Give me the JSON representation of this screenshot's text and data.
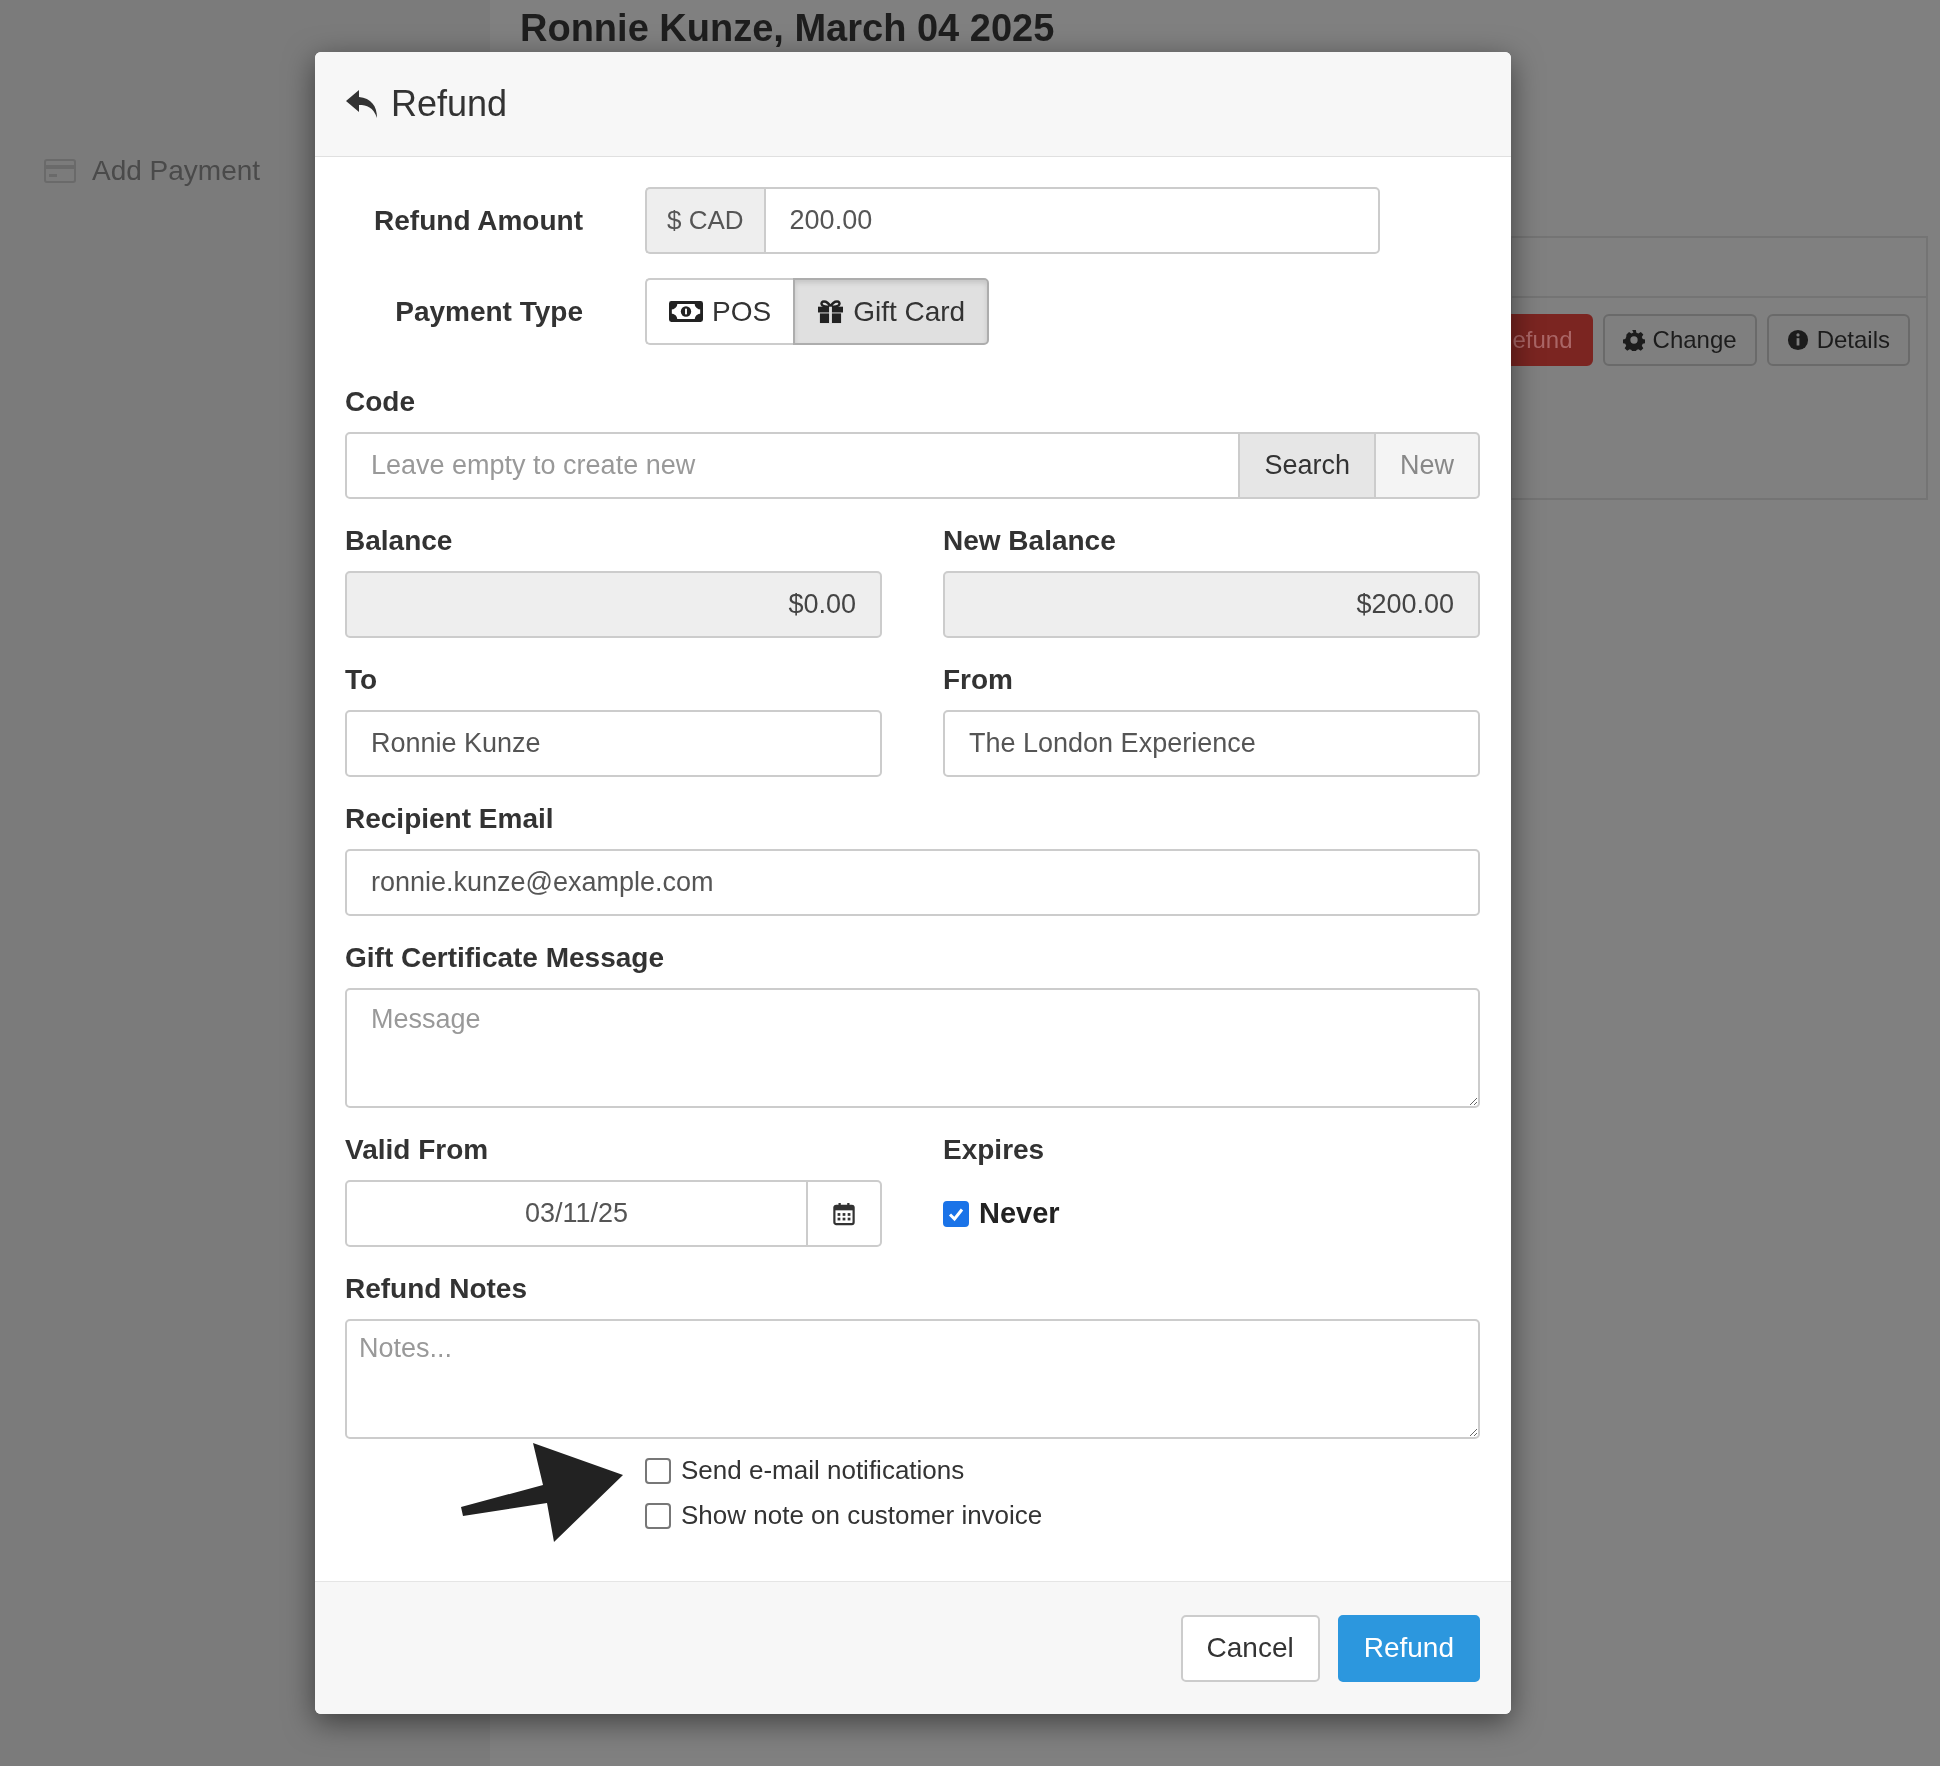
{
  "background": {
    "sidebar_link": "Add Payment",
    "heading": "Ronnie Kunze, March 04 2025",
    "actions": [
      {
        "label": "efund",
        "kind": "danger"
      },
      {
        "label": "Change",
        "kind": "settings"
      },
      {
        "label": "Details",
        "kind": "info"
      }
    ]
  },
  "modal": {
    "title": "Refund",
    "refund_amount": {
      "label": "Refund Amount",
      "addon": "$ CAD",
      "value": "200.00"
    },
    "payment_type": {
      "label": "Payment Type",
      "options": [
        {
          "label": "POS",
          "selected": false
        },
        {
          "label": "Gift Card",
          "selected": true
        }
      ]
    },
    "code": {
      "label": "Code",
      "placeholder": "Leave empty to create new",
      "buttons": [
        {
          "label": "Search",
          "disabled": false
        },
        {
          "label": "New",
          "disabled": true
        }
      ]
    },
    "balance": {
      "label": "Balance",
      "value": "$0.00",
      "readonly": true
    },
    "new_balance": {
      "label": "New Balance",
      "value": "$200.00",
      "readonly": true
    },
    "to": {
      "label": "To",
      "value": "Ronnie Kunze",
      "readonly": false
    },
    "from": {
      "label": "From",
      "value": "The London Experience",
      "readonly": false
    },
    "recipient_email": {
      "label": "Recipient Email",
      "value": "ronnie.kunze@example.com",
      "readonly": false
    },
    "gift_message": {
      "label": "Gift Certificate Message",
      "placeholder": "Message"
    },
    "valid_from": {
      "label": "Valid From",
      "value": "03/11/25"
    },
    "expires": {
      "label": "Expires",
      "option": "Never",
      "checked": true
    },
    "refund_notes": {
      "label": "Refund Notes",
      "placeholder": "Notes..."
    },
    "options": [
      {
        "label": "Send e-mail notifications",
        "checked": false
      },
      {
        "label": "Show note on customer invoice",
        "checked": false
      }
    ],
    "buttons": [
      {
        "label": "Cancel",
        "kind": "default"
      },
      {
        "label": "Refund",
        "kind": "primary"
      }
    ]
  }
}
